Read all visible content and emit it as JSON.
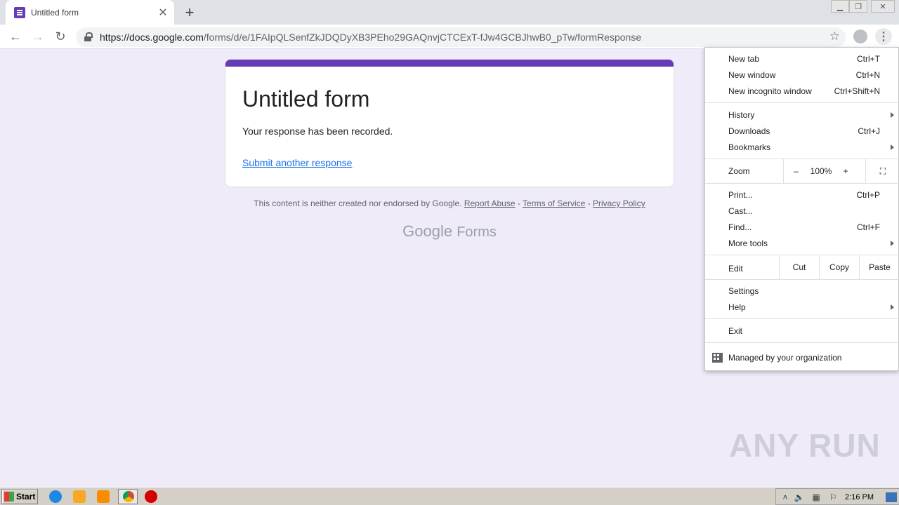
{
  "browser": {
    "tab_title": "Untitled form",
    "url_host": "https://docs.google.com",
    "url_path": "/forms/d/e/1FAIpQLSenfZkJDQDyXB3PEho29GAQnvjCTCExT-fJw4GCBJhwB0_pTw/formResponse"
  },
  "form": {
    "title": "Untitled form",
    "message": "Your response has been recorded.",
    "link": "Submit another response"
  },
  "footer": {
    "disclaimer": "This content is neither created nor endorsed by Google.",
    "report_abuse": "Report Abuse",
    "sep1": " - ",
    "terms": "Terms of Service",
    "sep2": " - ",
    "privacy": "Privacy Policy",
    "logo_google": "Google",
    "logo_forms": "Forms"
  },
  "menu": {
    "new_tab": "New tab",
    "new_tab_sc": "Ctrl+T",
    "new_window": "New window",
    "new_window_sc": "Ctrl+N",
    "incognito": "New incognito window",
    "incognito_sc": "Ctrl+Shift+N",
    "history": "History",
    "downloads": "Downloads",
    "downloads_sc": "Ctrl+J",
    "bookmarks": "Bookmarks",
    "zoom": "Zoom",
    "zoom_minus": "–",
    "zoom_value": "100%",
    "zoom_plus": "+",
    "print": "Print...",
    "print_sc": "Ctrl+P",
    "cast": "Cast...",
    "find": "Find...",
    "find_sc": "Ctrl+F",
    "more_tools": "More tools",
    "edit": "Edit",
    "cut": "Cut",
    "copy": "Copy",
    "paste": "Paste",
    "settings": "Settings",
    "help": "Help",
    "exit": "Exit",
    "managed": "Managed by your organization"
  },
  "taskbar": {
    "start": "Start",
    "clock": "2:16 PM"
  },
  "watermark": "ANY RUN",
  "colors": {
    "accent": "#673ab7",
    "page_bg": "#f0ebf8",
    "link": "#1a73e8"
  }
}
